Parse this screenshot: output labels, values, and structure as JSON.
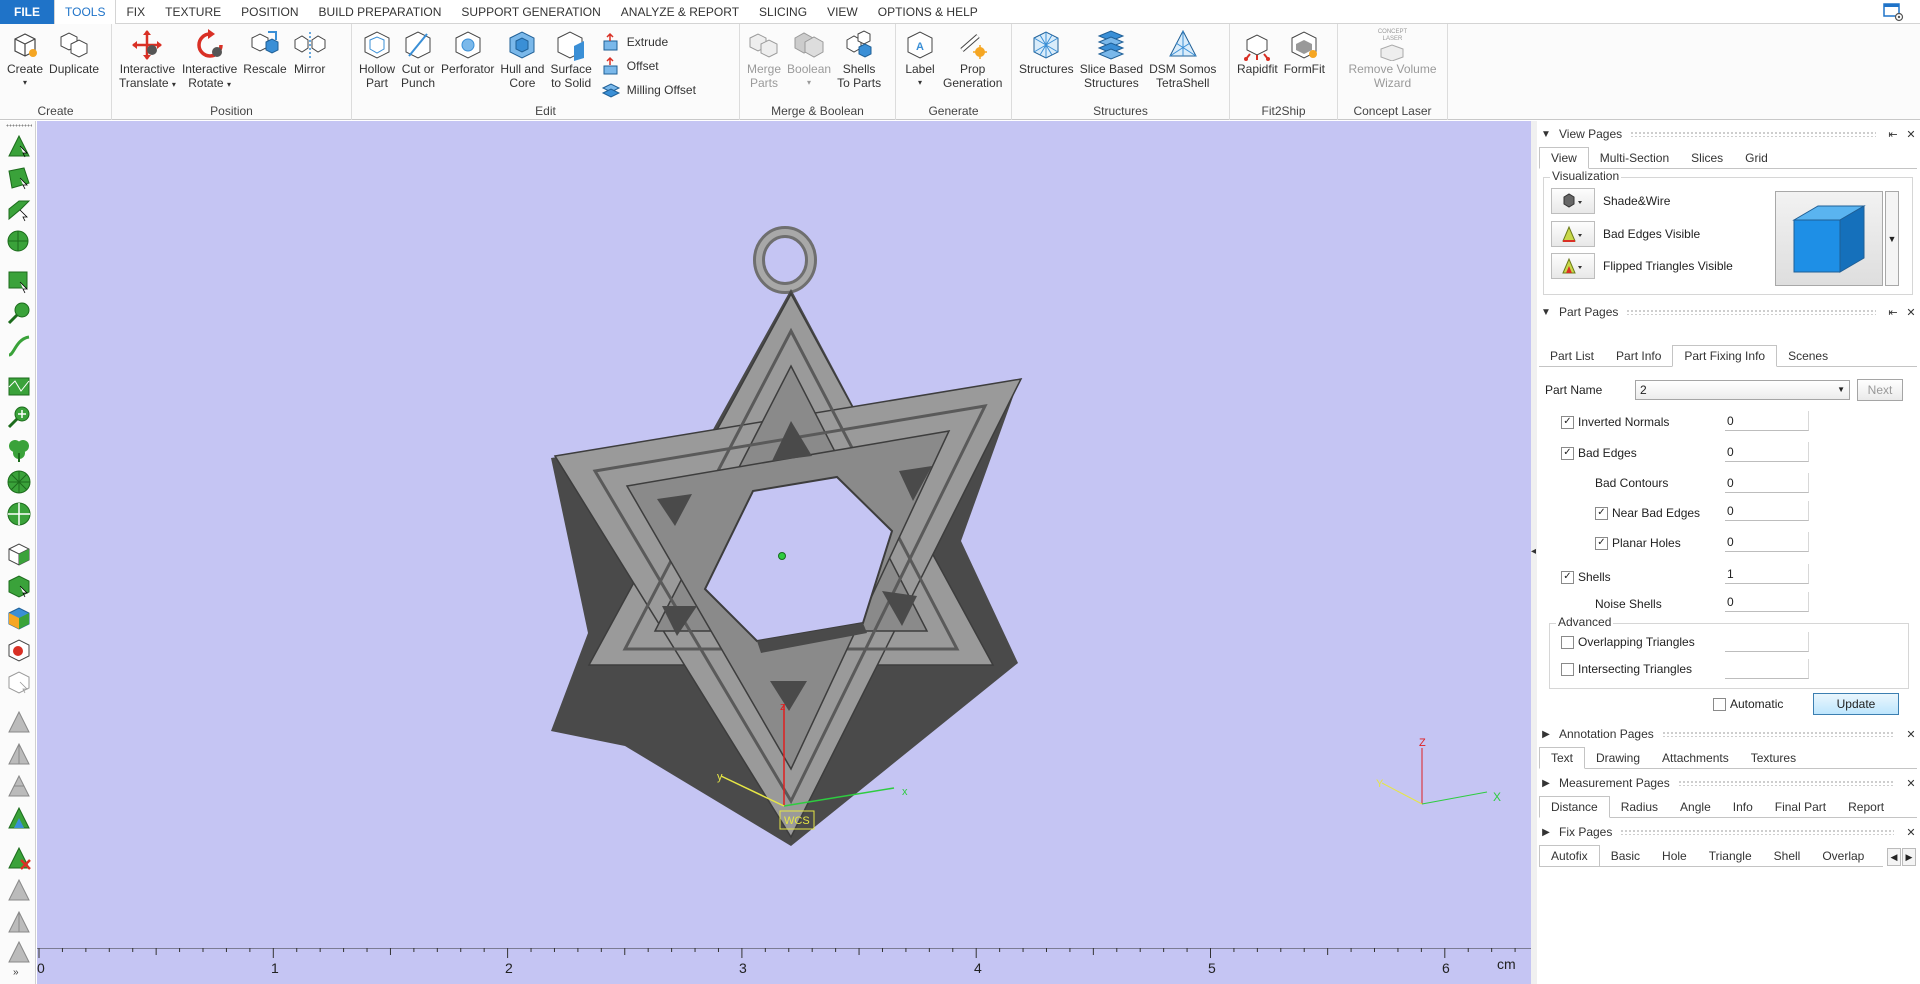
{
  "menu": {
    "items": [
      "FILE",
      "TOOLS",
      "FIX",
      "TEXTURE",
      "POSITION",
      "BUILD PREPARATION",
      "SUPPORT GENERATION",
      "ANALYZE & REPORT",
      "SLICING",
      "VIEW",
      "OPTIONS & HELP"
    ],
    "active": "TOOLS"
  },
  "ribbon": {
    "create": {
      "label": "Create",
      "create_btn": "Create",
      "duplicate_btn": "Duplicate"
    },
    "position": {
      "label": "Position",
      "translate_l1": "Interactive",
      "translate_l2": "Translate",
      "rotate_l1": "Interactive",
      "rotate_l2": "Rotate",
      "rescale": "Rescale",
      "mirror": "Mirror"
    },
    "edit": {
      "label": "Edit",
      "hollow_l1": "Hollow",
      "hollow_l2": "Part",
      "cut_l1": "Cut or",
      "cut_l2": "Punch",
      "perforator": "Perforator",
      "hull_l1": "Hull and",
      "hull_l2": "Core",
      "surface_l1": "Surface",
      "surface_l2": "to Solid",
      "extrude": "Extrude",
      "offset": "Offset",
      "milling_offset": "Milling Offset"
    },
    "merge": {
      "label": "Merge & Boolean",
      "merge_l1": "Merge",
      "merge_l2": "Parts",
      "boolean": "Boolean",
      "shells_l1": "Shells",
      "shells_l2": "To Parts"
    },
    "generate": {
      "label": "Generate",
      "label_btn": "Label",
      "prop_l1": "Prop",
      "prop_l2": "Generation"
    },
    "structures": {
      "label": "Structures",
      "structures_btn": "Structures",
      "slice_l1": "Slice Based",
      "slice_l2": "Structures",
      "dsm_l1": "DSM Somos",
      "dsm_l2": "TetraShell"
    },
    "fit2ship": {
      "label": "Fit2Ship",
      "rapidfit": "Rapidfit",
      "formfit": "FormFit"
    },
    "concept": {
      "label": "Concept Laser",
      "remove_l1": "Remove Volume",
      "remove_l2": "Wizard",
      "logo_text": "CONCEPT LASER"
    }
  },
  "viewport": {
    "background": "#c5c5f3",
    "wcs_label": "WCS",
    "axis_labels": {
      "x": "x",
      "y": "y",
      "z": "z"
    },
    "mini_axis_labels": {
      "x": "X",
      "y": "Y",
      "z": "Z"
    },
    "ruler": {
      "ticks": [
        "0",
        "1",
        "2",
        "3",
        "4",
        "5",
        "6"
      ],
      "unit": "cm"
    }
  },
  "right_panel": {
    "view_pages": {
      "title": "View Pages",
      "tabs": [
        "View",
        "Multi-Section",
        "Slices",
        "Grid"
      ],
      "active_tab": "View",
      "visualization": {
        "legend": "Visualization",
        "rows": [
          "Shade&Wire",
          "Bad Edges Visible",
          "Flipped Triangles Visible"
        ]
      }
    },
    "part_pages": {
      "title": "Part Pages",
      "tabs": [
        "Part List",
        "Part Info",
        "Part Fixing Info",
        "Scenes"
      ],
      "active_tab": "Part Fixing Info",
      "part_name_label": "Part Name",
      "part_name_value": "2",
      "next_btn": "Next",
      "fields": {
        "inverted_normals": {
          "label": "Inverted Normals",
          "value": "0",
          "checked": true
        },
        "bad_edges": {
          "label": "Bad Edges",
          "value": "0",
          "checked": true
        },
        "bad_contours": {
          "label": "Bad Contours",
          "value": "0"
        },
        "near_bad_edges": {
          "label": "Near Bad Edges",
          "value": "0",
          "checked": true
        },
        "planar_holes": {
          "label": "Planar Holes",
          "value": "0",
          "checked": true
        },
        "shells": {
          "label": "Shells",
          "value": "1",
          "checked": true
        },
        "noise_shells": {
          "label": "Noise Shells",
          "value": "0"
        },
        "advanced_legend": "Advanced",
        "overlapping": {
          "label": "Overlapping Triangles",
          "value": "",
          "checked": false
        },
        "intersecting": {
          "label": "Intersecting Triangles",
          "value": "",
          "checked": false
        }
      },
      "automatic_label": "Automatic",
      "update_btn": "Update"
    },
    "annotation_pages": {
      "title": "Annotation Pages",
      "tabs": [
        "Text",
        "Drawing",
        "Attachments",
        "Textures"
      ],
      "active_tab": "Text"
    },
    "measurement_pages": {
      "title": "Measurement Pages",
      "tabs": [
        "Distance",
        "Radius",
        "Angle",
        "Info",
        "Final Part",
        "Report"
      ],
      "active_tab": "Distance"
    },
    "fix_pages": {
      "title": "Fix Pages",
      "tabs": [
        "Autofix",
        "Basic",
        "Hole",
        "Triangle",
        "Shell",
        "Overlap"
      ],
      "active_tab": "Autofix"
    }
  },
  "colors": {
    "accent": "#1f73c8",
    "viewport_bg": "#c5c5f3",
    "model": "#8c8c8c",
    "x_axis": "#2ecc40",
    "y_axis": "#e6e645",
    "z_axis": "#e02020"
  }
}
